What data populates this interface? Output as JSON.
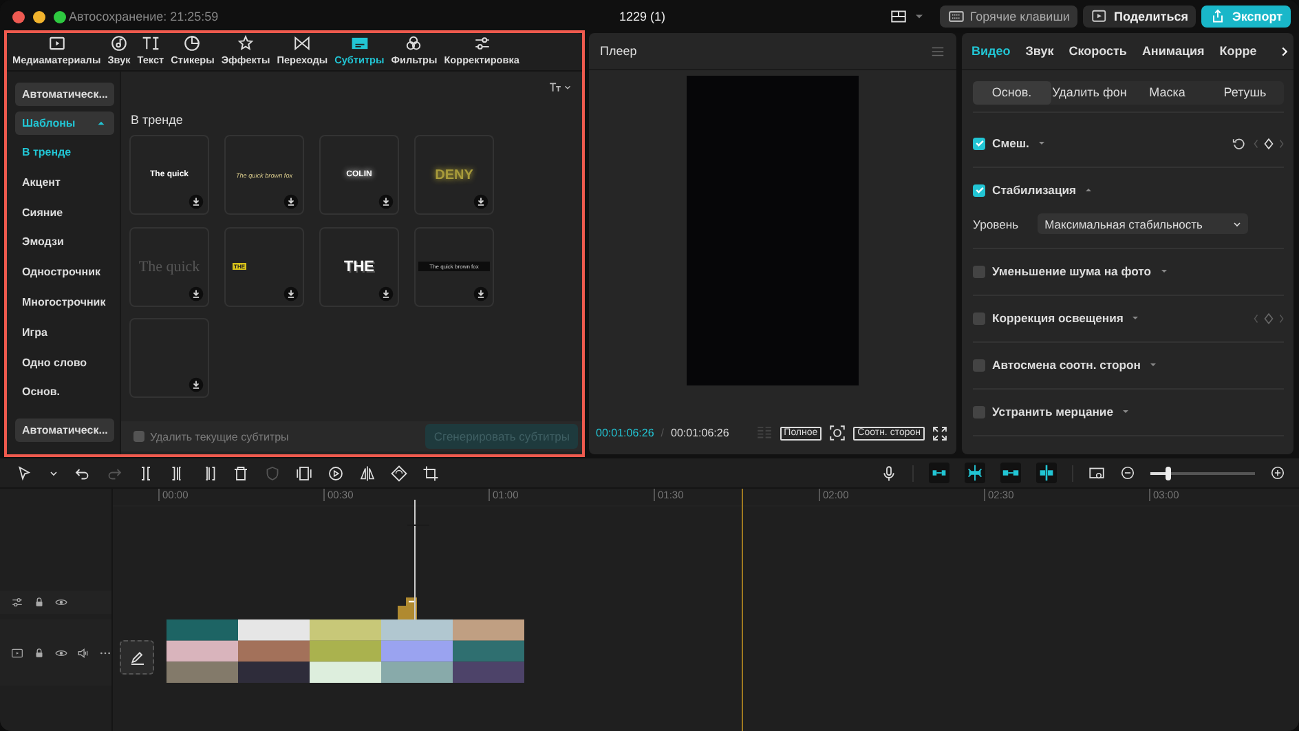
{
  "titlebar": {
    "autosave": "Автосохранение: 21:25:59",
    "project": "1229 (1)",
    "buttons": [
      {
        "label": "Горячие клавиши",
        "kind": "shortcuts"
      },
      {
        "label": "Поделиться",
        "kind": "share"
      },
      {
        "label": "Экспорт",
        "kind": "export"
      }
    ]
  },
  "media_tabs": [
    {
      "label": "Медиаматериалы",
      "kind": "media",
      "selected": false
    },
    {
      "label": "Звук",
      "kind": "audio",
      "selected": false
    },
    {
      "label": "Текст",
      "kind": "text",
      "selected": false
    },
    {
      "label": "Стикеры",
      "kind": "stickers",
      "selected": false
    },
    {
      "label": "Эффекты",
      "kind": "effects",
      "selected": false
    },
    {
      "label": "Переходы",
      "kind": "transitions",
      "selected": false
    },
    {
      "label": "Субтитры",
      "kind": "captions",
      "selected": true
    },
    {
      "label": "Фильтры",
      "kind": "filters",
      "selected": false
    },
    {
      "label": "Корректировка",
      "kind": "adjust",
      "selected": false
    }
  ],
  "sidebar": {
    "top_button": "Автоматическ...",
    "group": {
      "label": "Шаблоны",
      "expanded": true,
      "children": [
        {
          "label": "В тренде",
          "selected": true
        },
        {
          "label": "Акцент",
          "selected": false
        },
        {
          "label": "Сияние",
          "selected": false
        },
        {
          "label": "Эмодзи",
          "selected": false
        },
        {
          "label": "Однострочник",
          "selected": false
        },
        {
          "label": "Многострочник",
          "selected": false
        },
        {
          "label": "Игра",
          "selected": false
        },
        {
          "label": "Одно слово",
          "selected": false
        },
        {
          "label": "Основ.",
          "selected": false
        }
      ]
    },
    "bottom_button": "Автоматическ..."
  },
  "templates": {
    "section": "В тренде",
    "items": [
      {
        "kind": "plain",
        "text": "The quick"
      },
      {
        "kind": "italic",
        "text": "The quick brown fox"
      },
      {
        "kind": "glow",
        "text": "COLIN"
      },
      {
        "kind": "neon",
        "text": "DENY"
      },
      {
        "kind": "serif",
        "text": "The quick"
      },
      {
        "kind": "tag",
        "text": "THE"
      },
      {
        "kind": "outline",
        "text": "THE"
      },
      {
        "kind": "bar",
        "text": "The quick brown fox"
      },
      {
        "kind": "empty"
      }
    ]
  },
  "caption_footer": {
    "checkbox": {
      "label": "Удалить текущие субтитры",
      "checked": false,
      "disabled": true
    },
    "button": {
      "label": "Сгенерировать субтитры",
      "disabled": true
    }
  },
  "player": {
    "title": "Плеер",
    "current_time": "00:01:06:26",
    "separator": "/",
    "total_time": "00:01:06:26",
    "buttons": [
      "Полное",
      "Соотн. сторон"
    ]
  },
  "inspector": {
    "tabs": [
      {
        "label": "Видео",
        "selected": true
      },
      {
        "label": "Звук",
        "selected": false
      },
      {
        "label": "Скорость",
        "selected": false
      },
      {
        "label": "Анимация",
        "selected": false
      },
      {
        "label": "Корре",
        "selected": false
      }
    ],
    "subtabs": [
      {
        "label": "Основ.",
        "selected": true
      },
      {
        "label": "Удалить фон",
        "selected": false
      },
      {
        "label": "Маска",
        "selected": false
      },
      {
        "label": "Ретушь",
        "selected": false
      }
    ],
    "sections": [
      {
        "label": "Смеш.",
        "checked": true,
        "expanded": false,
        "reset": true,
        "keyframe": true
      },
      {
        "label": "Стабилизация",
        "checked": true,
        "expanded": true,
        "field": {
          "label": "Уровень",
          "value": "Максимальная стабильность"
        }
      },
      {
        "label": "Уменьшение шума на фото",
        "checked": false,
        "expanded": false
      },
      {
        "label": "Коррекция освещения",
        "checked": false,
        "expanded": false,
        "keyframe": true
      },
      {
        "label": "Автосмена соотн. сторон",
        "checked": false,
        "expanded": false
      },
      {
        "label": "Устранить мерцание",
        "checked": false,
        "expanded": false
      }
    ]
  },
  "timeline": {
    "ruler": [
      "00:00",
      "00:30",
      "01:00",
      "01:30",
      "02:00",
      "02:30",
      "03:00"
    ],
    "zoom": {
      "level": 0.17
    }
  }
}
